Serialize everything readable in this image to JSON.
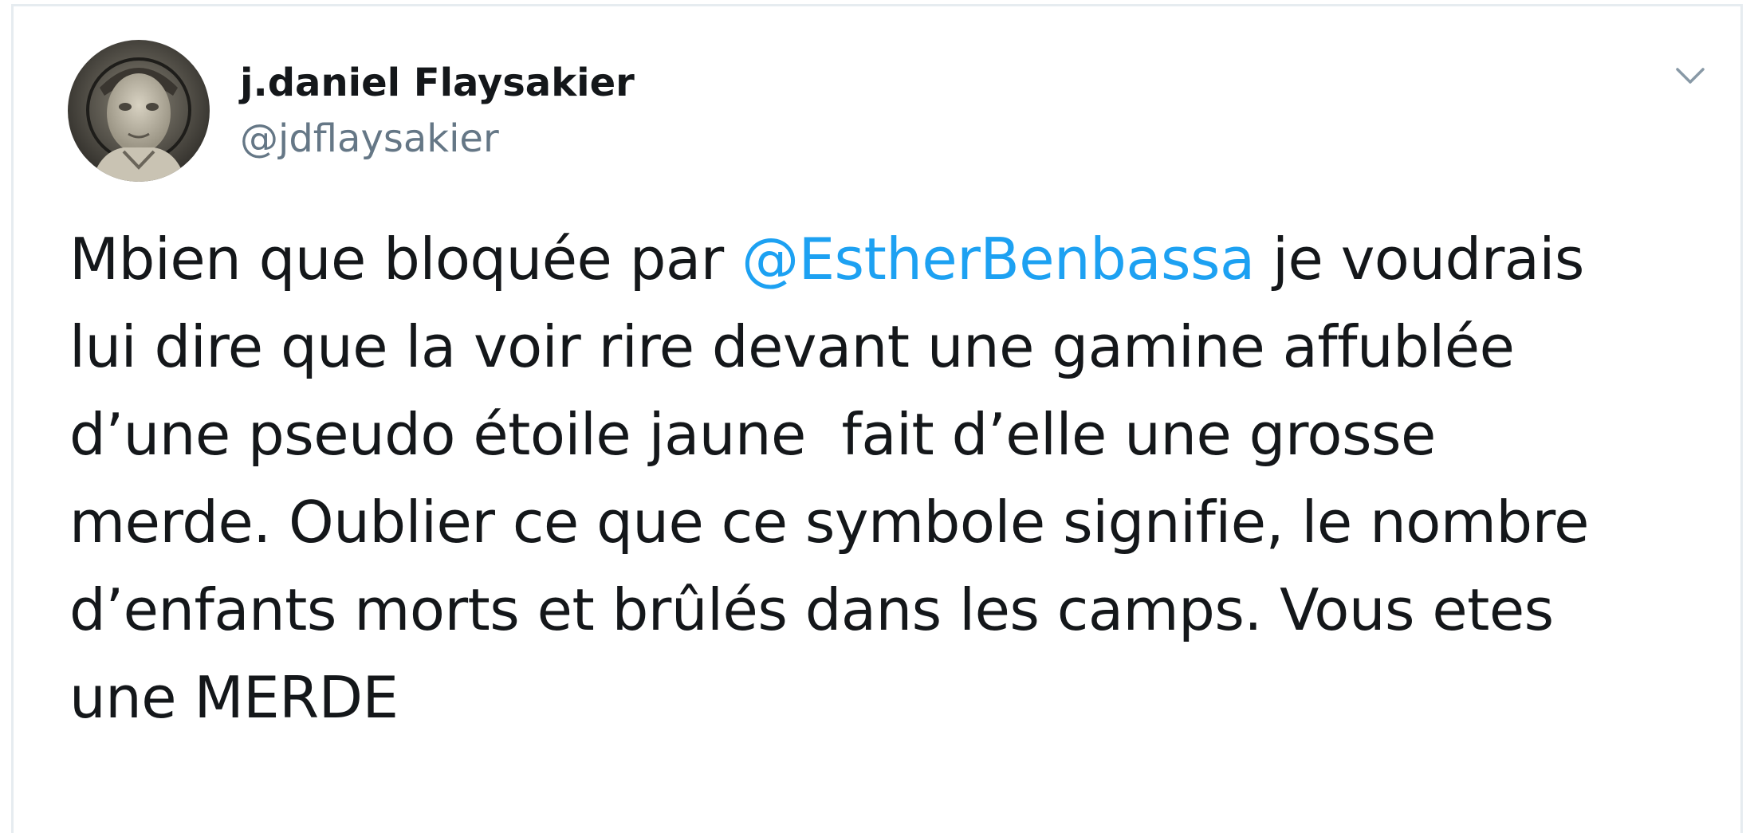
{
  "user": {
    "display_name": "j.daniel Flaysakier",
    "handle": "@jdflaysakier"
  },
  "tweet": {
    "line1_before": "Mbien que bloquée par ",
    "mention": "@EstherBenbassa",
    "line1_after": " je voudrais",
    "line2": "lui dire que la voir rire devant une gamine affublée",
    "line3": "d’une pseudo étoile jaune  fait d’elle une grosse",
    "line4": "merde. Oublier ce que ce symbole signifie, le nombre",
    "line5": "d’enfants morts et brûlés dans les camps. Vous etes",
    "line6": "une MERDE"
  },
  "colors": {
    "text": "#14171a",
    "handle": "#657786",
    "mention": "#1da1f2",
    "border": "#e6ecf0",
    "caret": "#8899a6"
  },
  "icons": {
    "caret": "chevron-down-icon",
    "avatar": "avatar-photo"
  }
}
